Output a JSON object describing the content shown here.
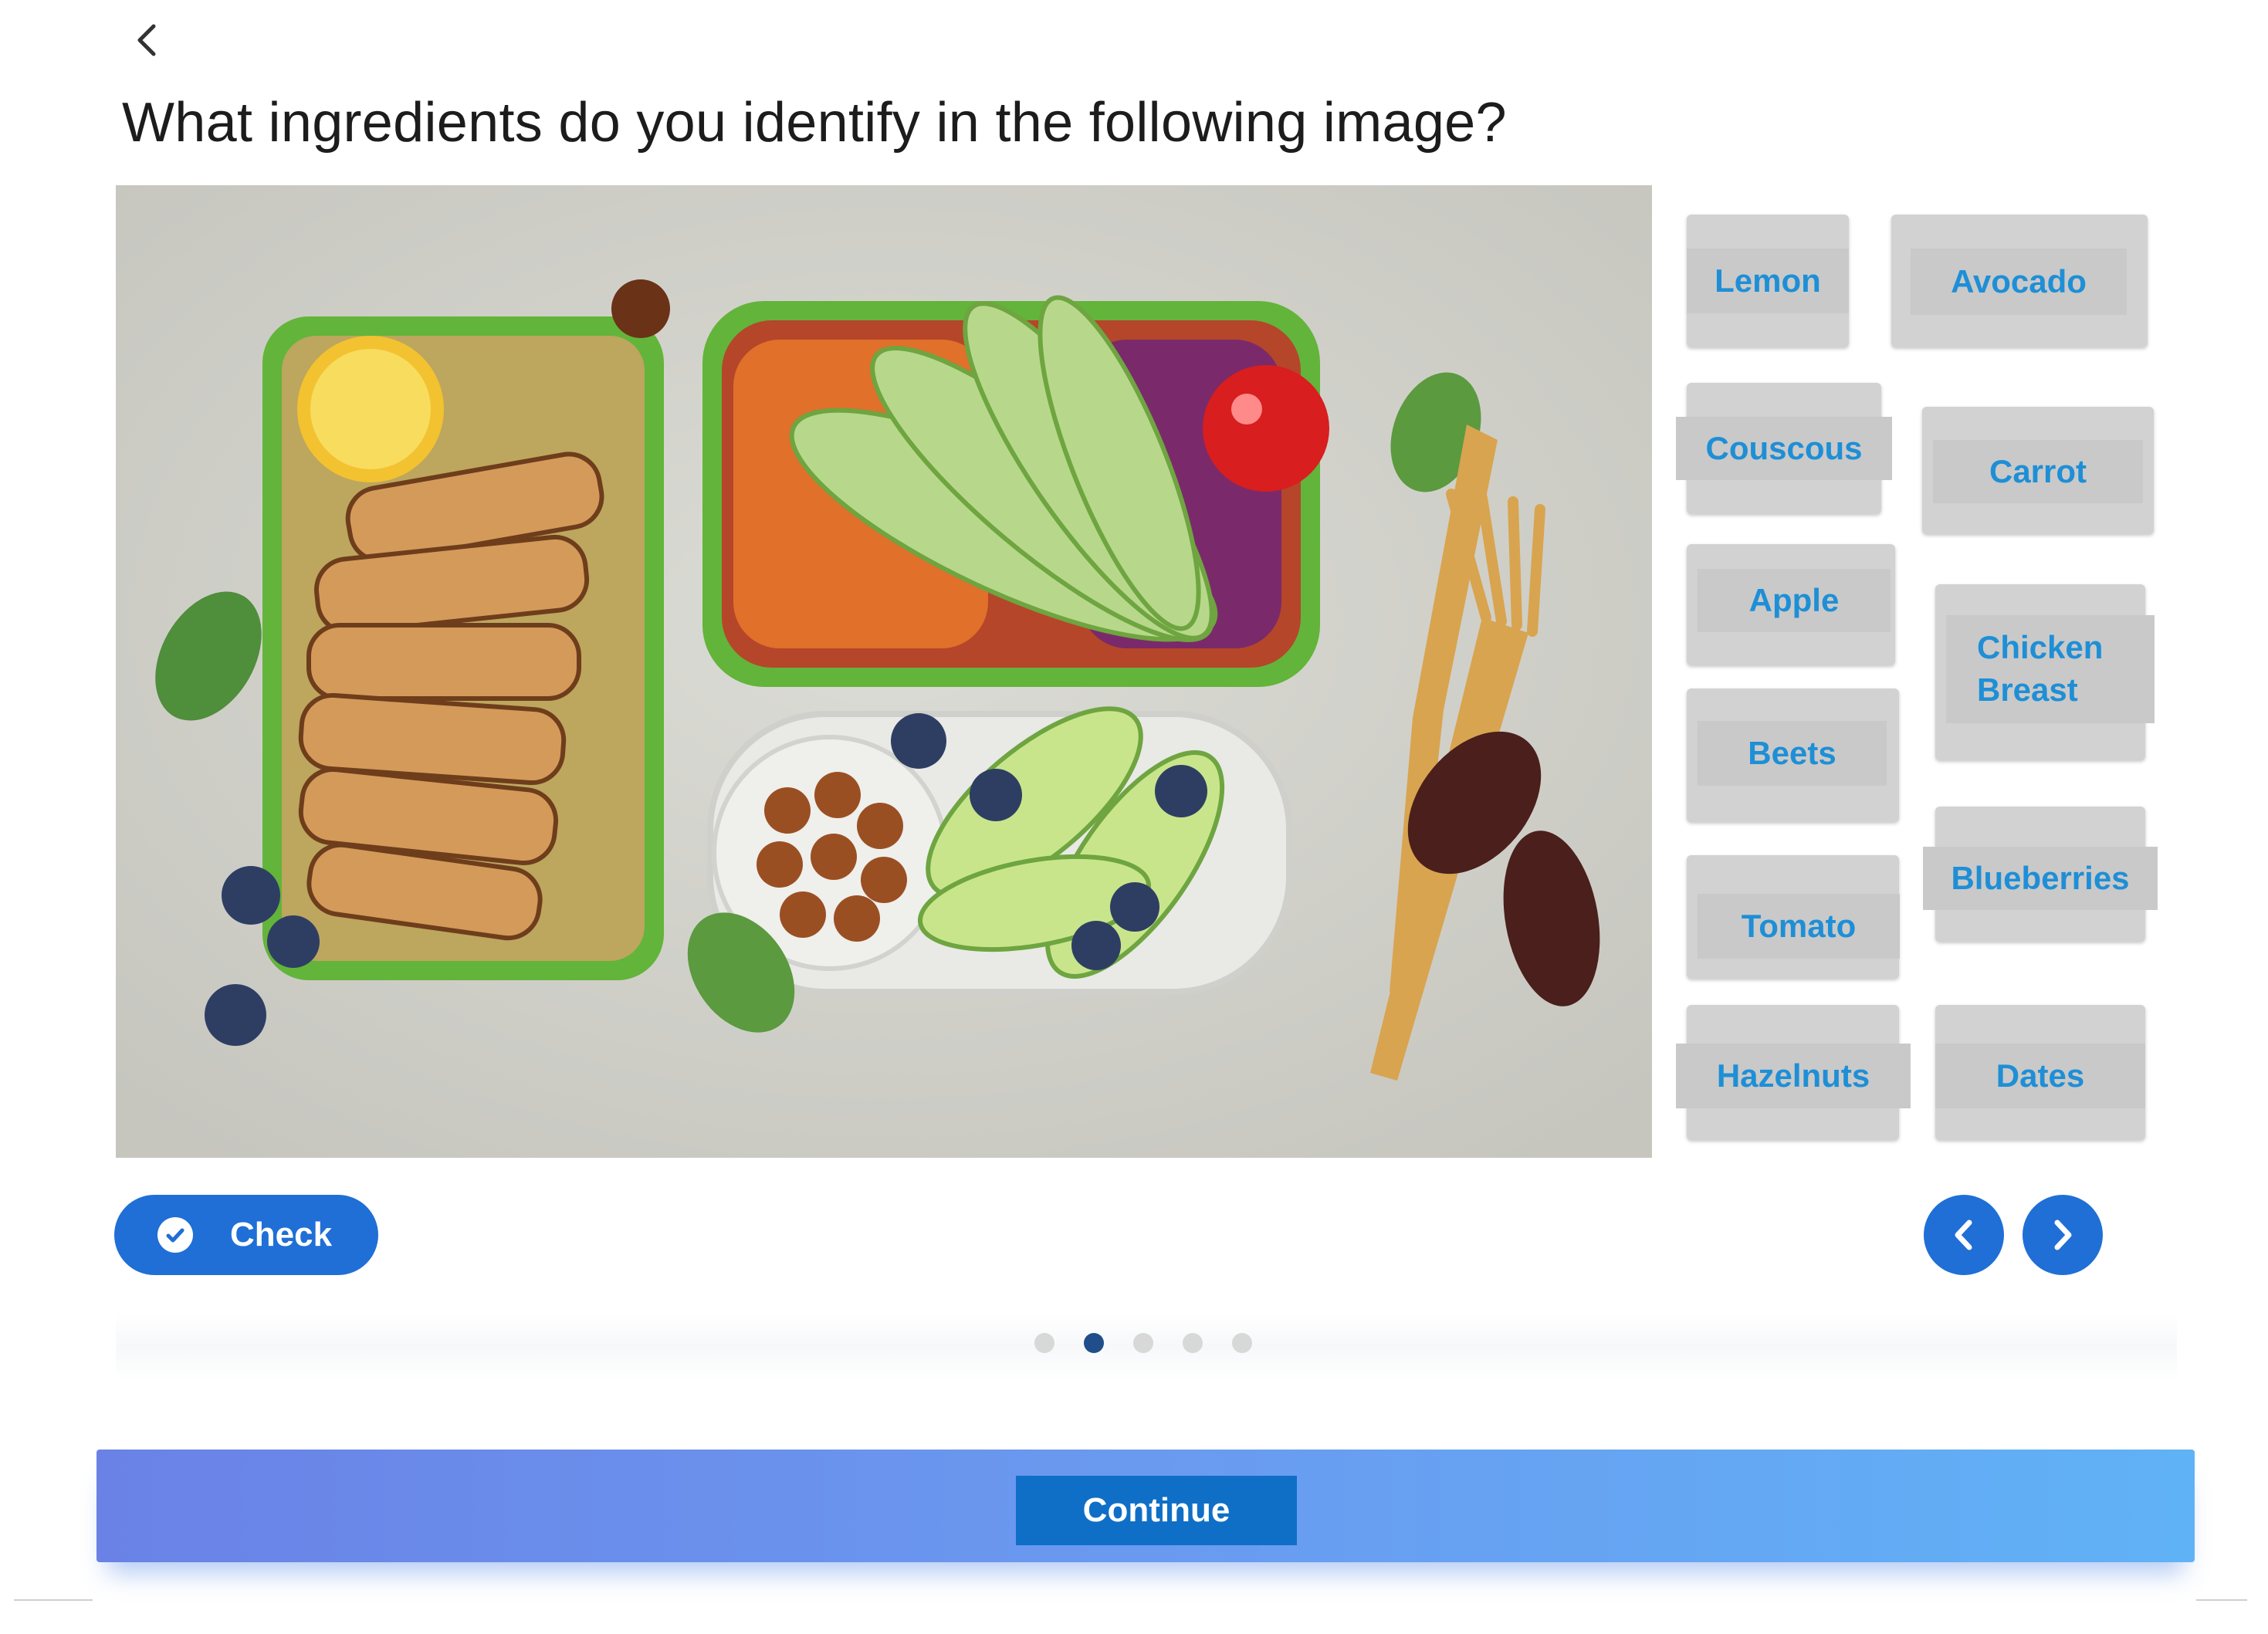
{
  "question": "What ingredients do you identify in the following image?",
  "ingredients": [
    "Lemon",
    "Avocado",
    "Couscous",
    "Carrot",
    "Apple",
    "Chicken Breast",
    "Beets",
    "Blueberries",
    "Tomato",
    "Hazelnuts",
    "Dates"
  ],
  "check_label": "Check",
  "continue_label": "Continue",
  "pagination": {
    "total": 5,
    "active": 2
  },
  "colors": {
    "chip_text": "#1e8fd6",
    "primary": "#1f6fd6",
    "active_dot": "#1f4e8a"
  },
  "icons": [
    "back-chevron-icon",
    "check-circle-icon",
    "chevron-left-icon",
    "chevron-right-icon"
  ]
}
